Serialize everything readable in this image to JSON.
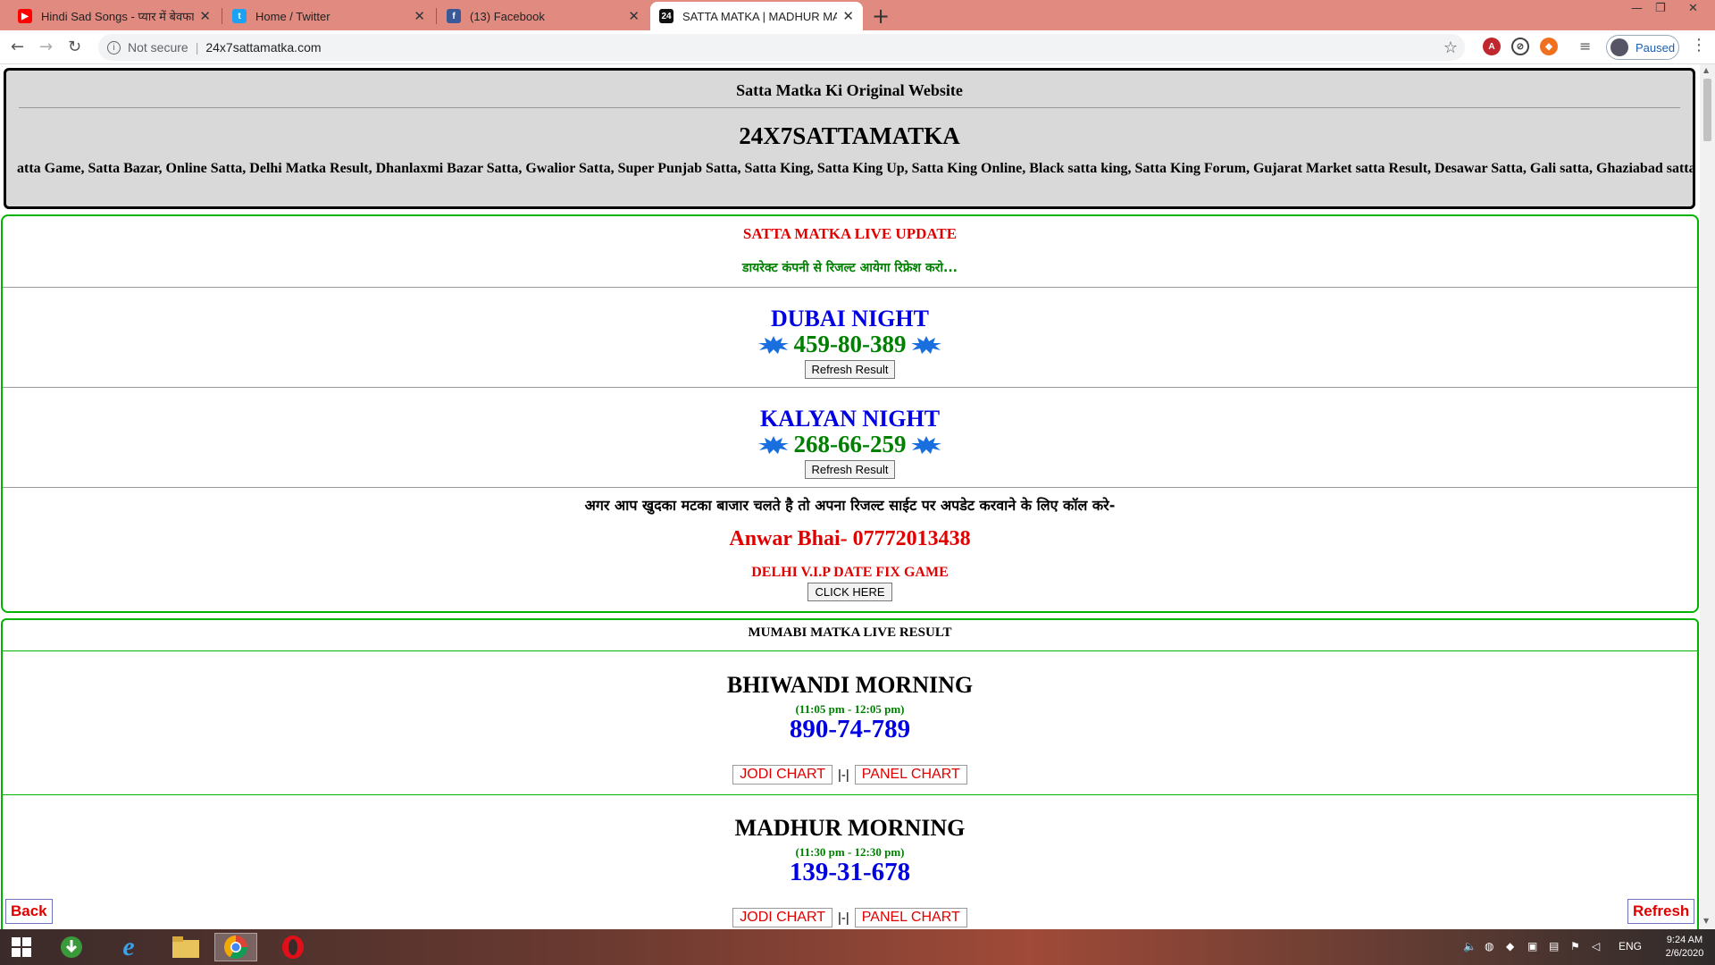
{
  "browser": {
    "tabs": [
      {
        "title": "Hindi Sad Songs - प्यार में बेवफाई",
        "favicon": "youtube-icon",
        "color": "#ff0000"
      },
      {
        "title": "Home / Twitter",
        "favicon": "twitter-icon",
        "color": "#1da1f2"
      },
      {
        "title": "(13) Facebook",
        "favicon": "facebook-icon",
        "color": "#3b5998"
      },
      {
        "title": "SATTA MATKA | MADHUR MATKA",
        "favicon": "site-icon",
        "color": "#111111"
      }
    ],
    "security_label": "Not secure",
    "url": "24x7sattamatka.com",
    "profile_label": "Paused"
  },
  "header": {
    "tagline": "Satta Matka Ki Original Website",
    "site_name": "24X7SATTAMATKA",
    "marquee": "atta Game, Satta Bazar, Online Satta, Delhi Matka Result, Dhanlaxmi Bazar Satta, Gwalior Satta, Super Punjab Satta, Satta King, Satta King Up, Satta King Online, Black satta king, Satta King Forum, Gujarat Market satta Result, Desawar Satta, Gali satta, Ghaziabad satta result, Uda"
  },
  "live": {
    "title": "SATTA MATKA LIVE UPDATE",
    "subtitle": "डायरेक्ट कंपनी से रिजल्ट आयेगा रिफ्रेश करो...",
    "games": [
      {
        "name": "DUBAI NIGHT",
        "number": "459-80-389",
        "button": "Refresh Result"
      },
      {
        "name": "KALYAN NIGHT",
        "number": "268-66-259",
        "button": "Refresh Result"
      }
    ],
    "notice": "अगर आप खुदका मटका बाजार चलते है तो अपना रिजल्ट साईट पर अपडेट करवाने के लिए कॉल करे-",
    "contact": "Anwar Bhai- 07772013438",
    "vip": "DELHI V.I.P DATE FIX GAME",
    "vip_button": "CLICK HERE"
  },
  "results": {
    "title": "MUMABI MATKA LIVE RESULT",
    "markets": [
      {
        "name": "BHIWANDI MORNING",
        "time": "(11:05 pm - 12:05 pm)",
        "number": "890-74-789"
      },
      {
        "name": "MADHUR MORNING",
        "time": "(11:30 pm - 12:30 pm)",
        "number": "139-31-678"
      }
    ],
    "jodi_label": "JODI CHART",
    "separator": "|-|",
    "panel_label": "PANEL CHART"
  },
  "float": {
    "back": "Back",
    "refresh": "Refresh"
  },
  "taskbar": {
    "lang": "ENG",
    "time": "9:24 AM",
    "date": "2/6/2020"
  }
}
